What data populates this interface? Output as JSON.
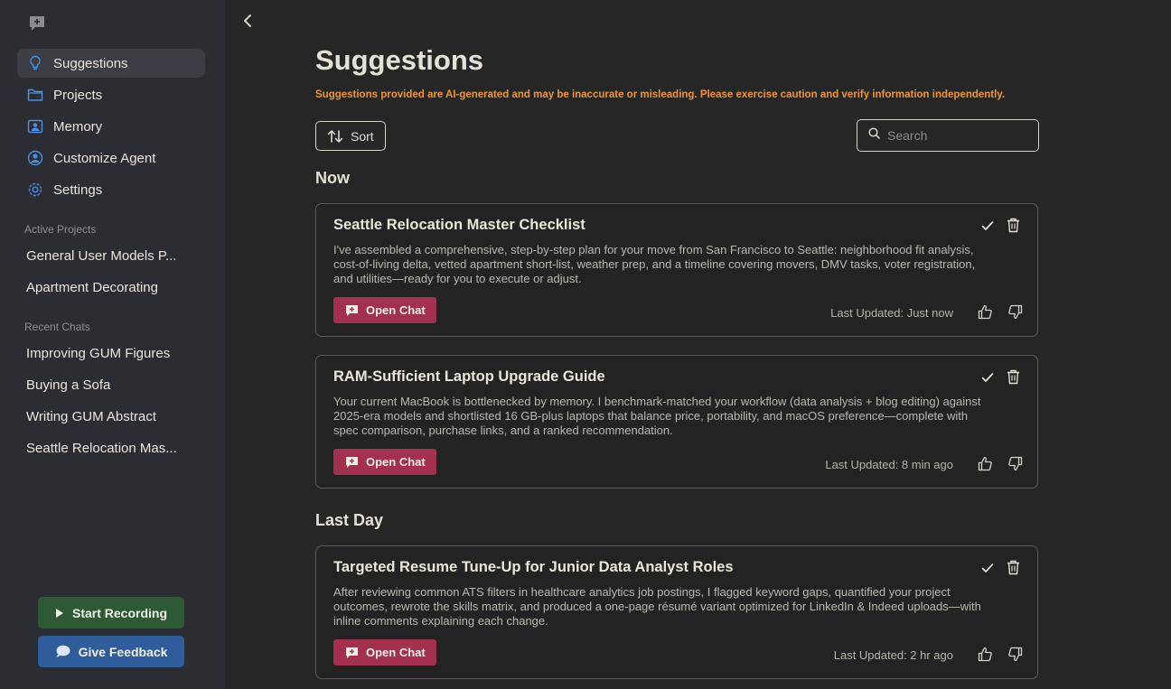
{
  "sidebar": {
    "nav": [
      {
        "label": "Suggestions",
        "icon": "lightbulb-icon"
      },
      {
        "label": "Projects",
        "icon": "folder-icon"
      },
      {
        "label": "Memory",
        "icon": "memory-icon"
      },
      {
        "label": "Customize Agent",
        "icon": "user-circle-icon"
      },
      {
        "label": "Settings",
        "icon": "settings-gear-icon"
      }
    ],
    "active_projects_label": "Active Projects",
    "active_projects": [
      "General User Models P...",
      "Apartment Decorating"
    ],
    "recent_chats_label": "Recent Chats",
    "recent_chats": [
      "Improving GUM Figures",
      "Buying a Sofa",
      "Writing GUM Abstract",
      "Seattle Relocation Mas..."
    ],
    "start_recording": "Start Recording",
    "give_feedback": "Give Feedback"
  },
  "main": {
    "title": "Suggestions",
    "warning": "Suggestions provided are AI-generated and may be inaccurate or misleading. Please exercise caution and verify information independently.",
    "sort_label": "Sort",
    "search_placeholder": "Search",
    "groups": [
      {
        "title": "Now",
        "cards": [
          {
            "title": "Seattle Relocation Master Checklist",
            "description": "I've assembled a comprehensive, step-by-step plan for your move from San Francisco to Seattle: neighborhood fit analysis, cost-of-living delta, vetted apartment short-list, weather prep, and a timeline covering movers, DMV tasks, voter registration, and utilities—ready for you to execute or adjust.",
            "open_chat": "Open Chat",
            "updated": "Last Updated: Just now"
          },
          {
            "title": "RAM-Sufficient Laptop Upgrade Guide",
            "description": "Your current MacBook is bottlenecked by memory. I benchmark-matched your workflow (data analysis + blog editing) against 2025-era models and shortlisted 16 GB-plus laptops that balance price, portability, and macOS preference—complete with spec comparison, purchase links, and a ranked recommendation.",
            "open_chat": "Open Chat",
            "updated": "Last Updated: 8 min ago"
          }
        ]
      },
      {
        "title": "Last Day",
        "cards": [
          {
            "title": "Targeted Resume Tune-Up for Junior Data Analyst Roles",
            "description": "After reviewing common ATS filters in healthcare analytics job postings, I flagged keyword gaps, quantified your project outcomes, rewrote the skills matrix, and produced a one-page résumé variant optimized for LinkedIn & Indeed uploads—with inline comments explaining each change.",
            "open_chat": "Open Chat",
            "updated": "Last Updated: 2 hr ago"
          }
        ]
      }
    ]
  },
  "colors": {
    "accent_open_chat": "#a3304f",
    "warning": "#f0962e",
    "record_button": "#2d5a35",
    "feedback_button": "#2f5c9a",
    "icon_blue": "#4a8fe8"
  }
}
